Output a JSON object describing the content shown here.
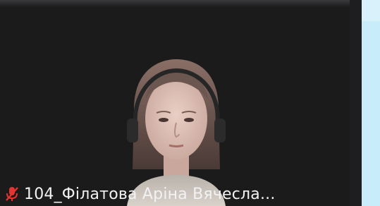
{
  "participant": {
    "name": "104_Філатова Аріна Вячесла...",
    "mic_state": "muted",
    "mic_icon": "mic-muted-icon"
  },
  "colors": {
    "tile_background": "#1b1b1c",
    "sidebar_background": "#c9ecfa",
    "mic_muted": "#e5342f",
    "name_text": "#f2f2f2"
  }
}
